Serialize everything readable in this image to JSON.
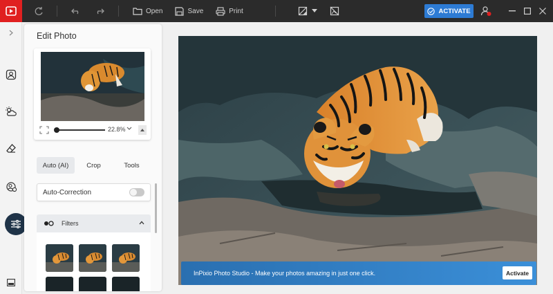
{
  "toolbar": {
    "open_label": "Open",
    "save_label": "Save",
    "print_label": "Print",
    "activate_label": "ACTIVATE"
  },
  "sidebar": {
    "items": [
      {
        "icon": "chevron-right-icon"
      },
      {
        "icon": "person-frame-icon"
      },
      {
        "icon": "cloud-sun-icon"
      },
      {
        "icon": "eraser-icon"
      },
      {
        "icon": "people-swap-icon"
      },
      {
        "icon": "sliders-icon",
        "active": true
      },
      {
        "icon": "bottom-panel-icon"
      }
    ]
  },
  "panel": {
    "title": "Edit Photo",
    "zoom_value": "22.8%",
    "tabs": [
      {
        "label": "Auto (AI)",
        "active": true
      },
      {
        "label": "Crop"
      },
      {
        "label": "Tools"
      }
    ],
    "auto_correction_label": "Auto-Correction",
    "auto_correction_on": false,
    "filters_label": "Filters"
  },
  "banner": {
    "text": "InPixio Photo Studio - Make your photos amazing in just one click.",
    "button_label": "Activate"
  },
  "colors": {
    "accent": "#2d7bd4",
    "titlebar": "#2b2b2b",
    "logo": "#e02020",
    "sidebar_active": "#1f3348"
  }
}
